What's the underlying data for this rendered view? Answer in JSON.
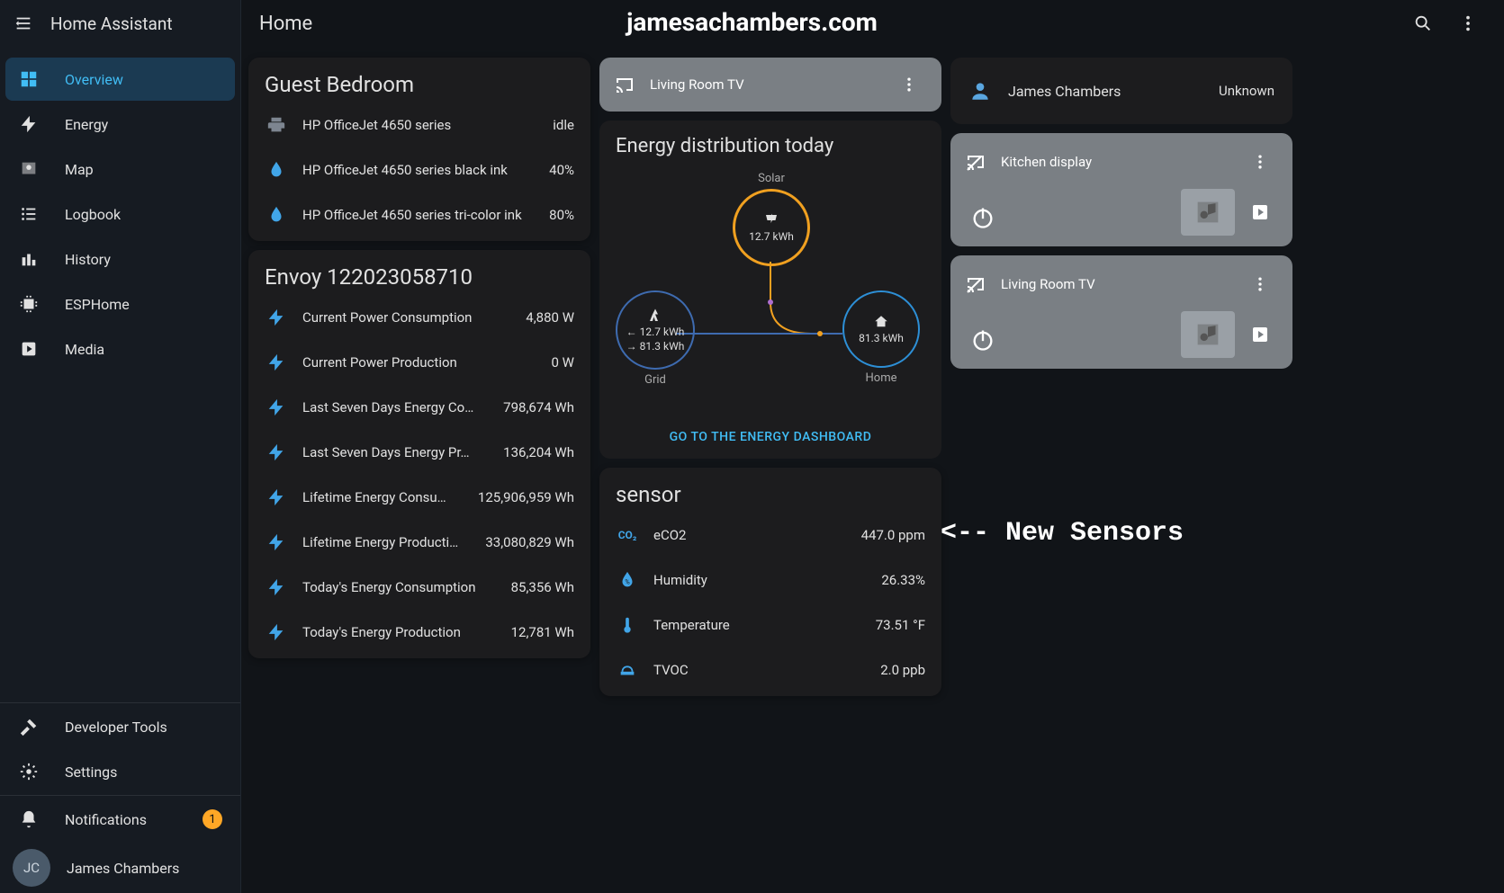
{
  "app": {
    "title": "Home Assistant",
    "page_title": "Home"
  },
  "overlay": {
    "site": "jamesachambers.com",
    "arrow": "<-- New Sensors"
  },
  "sidebar": {
    "items": [
      {
        "label": "Overview",
        "icon": "dashboard-icon",
        "selected": true
      },
      {
        "label": "Energy",
        "icon": "bolt-icon"
      },
      {
        "label": "Map",
        "icon": "map-icon"
      },
      {
        "label": "Logbook",
        "icon": "list-icon"
      },
      {
        "label": "History",
        "icon": "chart-icon"
      },
      {
        "label": "ESPHome",
        "icon": "chip-icon"
      },
      {
        "label": "Media",
        "icon": "media-icon"
      }
    ],
    "tools": [
      {
        "label": "Developer Tools",
        "icon": "hammer-icon"
      },
      {
        "label": "Settings",
        "icon": "gear-icon"
      }
    ],
    "footer": {
      "notifications_label": "Notifications",
      "notifications_count": "1",
      "user_initials": "JC",
      "user_name": "James Chambers"
    }
  },
  "col1": {
    "card1": {
      "title": "Guest Bedroom",
      "rows": [
        {
          "icon": "printer-icon",
          "name": "HP OfficeJet 4650 series",
          "value": "idle",
          "gray": true
        },
        {
          "icon": "water-drop-icon",
          "name": "HP OfficeJet 4650 series black ink",
          "value": "40%"
        },
        {
          "icon": "water-drop-icon",
          "name": "HP OfficeJet 4650 series tri-color ink",
          "value": "80%"
        }
      ]
    },
    "card2": {
      "title": "Envoy 122023058710",
      "rows": [
        {
          "icon": "flash-icon",
          "name": "Current Power Consumption",
          "value": "4,880 W"
        },
        {
          "icon": "flash-icon",
          "name": "Current Power Production",
          "value": "0 W"
        },
        {
          "icon": "flash-icon",
          "name": "Last Seven Days Energy Co…",
          "value": "798,674 Wh"
        },
        {
          "icon": "flash-icon",
          "name": "Last Seven Days Energy Pr…",
          "value": "136,204 Wh"
        },
        {
          "icon": "flash-icon",
          "name": "Lifetime Energy Consu…",
          "value": "125,906,959 Wh"
        },
        {
          "icon": "flash-icon",
          "name": "Lifetime Energy Producti…",
          "value": "33,080,829 Wh"
        },
        {
          "icon": "flash-icon",
          "name": "Today's Energy Consumption",
          "value": "85,356 Wh"
        },
        {
          "icon": "flash-icon",
          "name": "Today's Energy Production",
          "value": "12,781 Wh"
        }
      ]
    }
  },
  "col2": {
    "tv_card": {
      "title": "Living Room TV"
    },
    "energy": {
      "title": "Energy distribution today",
      "solar": {
        "label": "Solar",
        "value": "12.7 kWh"
      },
      "grid": {
        "label": "Grid",
        "in": "12.7 kWh",
        "out": "81.3 kWh"
      },
      "home": {
        "label": "Home",
        "value": "81.3 kWh"
      },
      "link": "GO TO THE ENERGY DASHBOARD"
    },
    "sensor": {
      "title": "sensor",
      "rows": [
        {
          "icon": "co2-icon",
          "name": "eCO2",
          "value": "447.0 ppm"
        },
        {
          "icon": "water-percent-icon",
          "name": "Humidity",
          "value": "26.33%"
        },
        {
          "icon": "thermometer-icon",
          "name": "Temperature",
          "value": "73.51 °F"
        },
        {
          "icon": "tvoc-icon",
          "name": "TVOC",
          "value": "2.0 ppb"
        }
      ]
    }
  },
  "col3": {
    "person": {
      "name": "James Chambers",
      "state": "Unknown"
    },
    "media": [
      {
        "title": "Kitchen display"
      },
      {
        "title": "Living Room TV"
      }
    ]
  }
}
